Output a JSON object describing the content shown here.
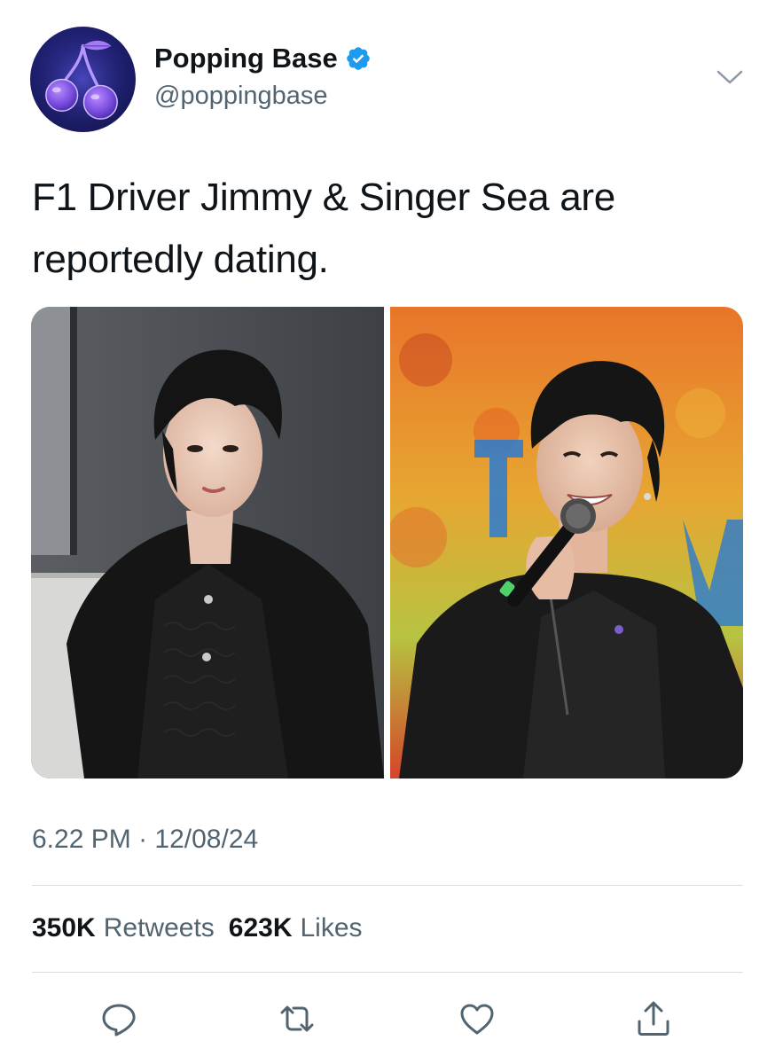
{
  "account": {
    "display_name": "Popping Base",
    "handle": "@poppingbase",
    "verified": true,
    "avatar_icon": "cherry-icon"
  },
  "tweet": {
    "text_line1": "F1 Driver Jimmy & Singer Sea are",
    "text_line2": "reportedly dating.",
    "time": "6.22 PM",
    "separator": "·",
    "date": "12/08/24"
  },
  "media": {
    "photos": [
      {
        "name": "photo-jimmy"
      },
      {
        "name": "photo-sea"
      }
    ]
  },
  "stats": {
    "retweets_count": "350K",
    "retweets_label": "Retweets",
    "likes_count": "623K",
    "likes_label": "Likes"
  },
  "actions": {
    "reply_icon": "reply-icon",
    "retweet_icon": "retweet-icon",
    "like_icon": "heart-icon",
    "share_icon": "share-icon"
  },
  "colors": {
    "text_primary": "#0f1419",
    "text_secondary": "#536471",
    "verified_blue": "#1d9bf0",
    "divider": "#d9dde0",
    "icon": "#536471"
  }
}
